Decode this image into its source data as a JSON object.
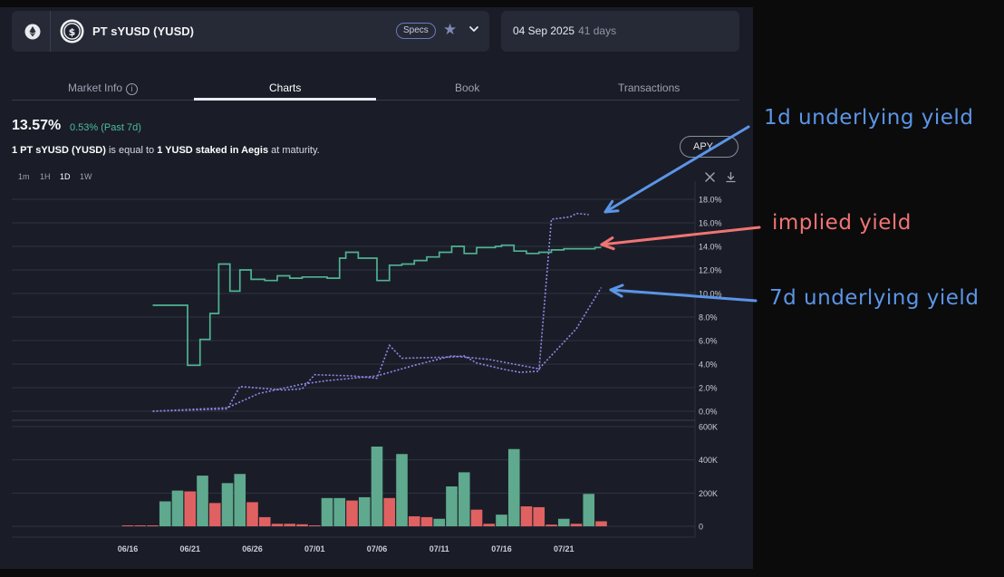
{
  "header": {
    "pt_name": "PT sYUSD (YUSD)",
    "specs_label": "Specs",
    "maturity_date": "04 Sep 2025",
    "days_left": "41 days"
  },
  "tabs": [
    {
      "label": "Market Info"
    },
    {
      "label": "Charts",
      "active": true
    },
    {
      "label": "Book"
    },
    {
      "label": "Transactions"
    }
  ],
  "summary": {
    "value": "13.57%",
    "change": "0.53% (Past 7d)",
    "desc_pre": "1 PT sYUSD (YUSD)",
    "desc_mid1": " is equal to ",
    "desc_bold2": "1 YUSD staked in Aegis",
    "desc_post": " at maturity."
  },
  "apy_select": "APY",
  "timeframes": [
    "1m",
    "1H",
    "1D",
    "1W"
  ],
  "active_timeframe": "1D",
  "colors": {
    "implied": "#4fb391",
    "underlying": "#8f8ae8",
    "buy": "#5fa98e",
    "sell": "#e06161",
    "ann_blue": "#5b95e6",
    "ann_red": "#f07474"
  },
  "chart_data": {
    "type": "line",
    "x_ticks": [
      "06/16",
      "06/21",
      "06/26",
      "07/01",
      "07/06",
      "07/11",
      "07/16",
      "07/21"
    ],
    "yield_axis": {
      "ticks": [
        "18.0%",
        "16.0%",
        "14.0%",
        "12.0%",
        "10.0%",
        "8.0%",
        "6.0%",
        "4.0%",
        "2.0%",
        "0.0%"
      ],
      "range": [
        0,
        18
      ]
    },
    "volume_axis": {
      "ticks": [
        "600K",
        "400K",
        "200K",
        "0"
      ],
      "range": [
        0,
        600000
      ]
    },
    "implied_yield": {
      "steps": [
        [
          18.0,
          9.0
        ],
        [
          20.8,
          9.0
        ],
        [
          20.8,
          3.9
        ],
        [
          21.8,
          3.9
        ],
        [
          21.8,
          6.1
        ],
        [
          22.6,
          6.1
        ],
        [
          22.6,
          8.3
        ],
        [
          23.3,
          8.3
        ],
        [
          23.3,
          12.5
        ],
        [
          24.2,
          12.5
        ],
        [
          24.2,
          10.2
        ],
        [
          25.0,
          10.2
        ],
        [
          25.0,
          12.0
        ],
        [
          25.9,
          12.0
        ],
        [
          25.9,
          11.2
        ],
        [
          27.0,
          11.2
        ],
        [
          27.0,
          11.1
        ],
        [
          28.0,
          11.1
        ],
        [
          28.0,
          11.5
        ],
        [
          29.0,
          11.5
        ],
        [
          29.0,
          11.3
        ],
        [
          30.0,
          11.3
        ],
        [
          30.0,
          11.4
        ],
        [
          32.0,
          11.4
        ],
        [
          32.0,
          11.3
        ],
        [
          33.0,
          11.3
        ],
        [
          33.0,
          13.0
        ],
        [
          33.5,
          13.0
        ],
        [
          33.5,
          13.5
        ],
        [
          34.5,
          13.5
        ],
        [
          34.5,
          13.0
        ],
        [
          36.0,
          13.0
        ],
        [
          36.0,
          11.1
        ],
        [
          37.0,
          11.1
        ],
        [
          37.0,
          12.4
        ],
        [
          38.0,
          12.4
        ],
        [
          38.0,
          12.5
        ],
        [
          39.0,
          12.5
        ],
        [
          39.0,
          12.8
        ],
        [
          40.0,
          12.8
        ],
        [
          40.0,
          13.1
        ],
        [
          41.0,
          13.1
        ],
        [
          41.0,
          13.5
        ],
        [
          42.0,
          13.5
        ],
        [
          42.0,
          14.0
        ],
        [
          43.0,
          14.0
        ],
        [
          43.0,
          13.4
        ],
        [
          44.0,
          13.4
        ],
        [
          44.0,
          13.9
        ],
        [
          45.5,
          13.9
        ],
        [
          45.5,
          14.0
        ],
        [
          46.0,
          14.0
        ],
        [
          46.0,
          14.1
        ],
        [
          47.0,
          14.1
        ],
        [
          47.0,
          13.6
        ],
        [
          48.0,
          13.6
        ],
        [
          48.0,
          13.4
        ],
        [
          49.0,
          13.4
        ],
        [
          49.0,
          13.5
        ],
        [
          50.0,
          13.5
        ],
        [
          50.0,
          13.7
        ],
        [
          51.0,
          13.7
        ],
        [
          51.0,
          13.8
        ],
        [
          53.5,
          13.8
        ],
        [
          53.5,
          13.9
        ],
        [
          54.0,
          13.9
        ]
      ]
    },
    "underlying_1d": {
      "points": [
        [
          18.0,
          0.0
        ],
        [
          24.0,
          0.2
        ],
        [
          25.0,
          2.1
        ],
        [
          28.5,
          1.8
        ],
        [
          30.0,
          1.9
        ],
        [
          31.0,
          3.1
        ],
        [
          34.0,
          3.0
        ],
        [
          36.0,
          2.8
        ],
        [
          37.0,
          5.6
        ],
        [
          38.0,
          4.5
        ],
        [
          42.0,
          4.6
        ],
        [
          43.0,
          4.7
        ],
        [
          44.0,
          4.1
        ],
        [
          46.0,
          3.6
        ],
        [
          47.5,
          3.3
        ],
        [
          49.0,
          3.4
        ],
        [
          50.0,
          16.3
        ],
        [
          51.5,
          16.5
        ],
        [
          52.0,
          16.8
        ],
        [
          53.0,
          16.7
        ]
      ]
    },
    "underlying_7d": {
      "points": [
        [
          18.0,
          0.0
        ],
        [
          24.0,
          0.3
        ],
        [
          26.5,
          1.5
        ],
        [
          30.0,
          2.3
        ],
        [
          32.0,
          2.6
        ],
        [
          36.0,
          3.0
        ],
        [
          39.0,
          3.9
        ],
        [
          42.0,
          4.7
        ],
        [
          45.0,
          4.4
        ],
        [
          49.0,
          3.6
        ],
        [
          52.0,
          7.0
        ],
        [
          54.0,
          10.5
        ]
      ]
    },
    "volume": [
      {
        "value": 1,
        "side": "sell"
      },
      {
        "value": 1,
        "side": "sell"
      },
      {
        "value": 1,
        "side": "sell"
      },
      {
        "value": 150000,
        "side": "buy"
      },
      {
        "value": 215000,
        "side": "buy"
      },
      {
        "value": 210000,
        "side": "sell"
      },
      {
        "value": 305000,
        "side": "buy"
      },
      {
        "value": 140000,
        "side": "sell"
      },
      {
        "value": 260000,
        "side": "buy"
      },
      {
        "value": 315000,
        "side": "buy"
      },
      {
        "value": 145000,
        "side": "sell"
      },
      {
        "value": 55000,
        "side": "sell"
      },
      {
        "value": 15000,
        "side": "sell"
      },
      {
        "value": 15000,
        "side": "sell"
      },
      {
        "value": 12000,
        "side": "sell"
      },
      {
        "value": 5000,
        "side": "sell"
      },
      {
        "value": 170000,
        "side": "buy"
      },
      {
        "value": 170000,
        "side": "buy"
      },
      {
        "value": 155000,
        "side": "sell"
      },
      {
        "value": 175000,
        "side": "buy"
      },
      {
        "value": 480000,
        "side": "buy"
      },
      {
        "value": 170000,
        "side": "sell"
      },
      {
        "value": 435000,
        "side": "buy"
      },
      {
        "value": 60000,
        "side": "sell"
      },
      {
        "value": 55000,
        "side": "sell"
      },
      {
        "value": 45000,
        "side": "buy"
      },
      {
        "value": 240000,
        "side": "buy"
      },
      {
        "value": 325000,
        "side": "buy"
      },
      {
        "value": 100000,
        "side": "sell"
      },
      {
        "value": 15000,
        "side": "sell"
      },
      {
        "value": 70000,
        "side": "buy"
      },
      {
        "value": 465000,
        "side": "buy"
      },
      {
        "value": 120000,
        "side": "sell"
      },
      {
        "value": 115000,
        "side": "sell"
      },
      {
        "value": 10000,
        "side": "sell"
      },
      {
        "value": 45000,
        "side": "buy"
      },
      {
        "value": 15000,
        "side": "sell"
      },
      {
        "value": 195000,
        "side": "buy"
      },
      {
        "value": 30000,
        "side": "sell"
      }
    ],
    "annotations": [
      "1d underlying yield",
      "implied yield",
      "7d underlying yield"
    ]
  }
}
